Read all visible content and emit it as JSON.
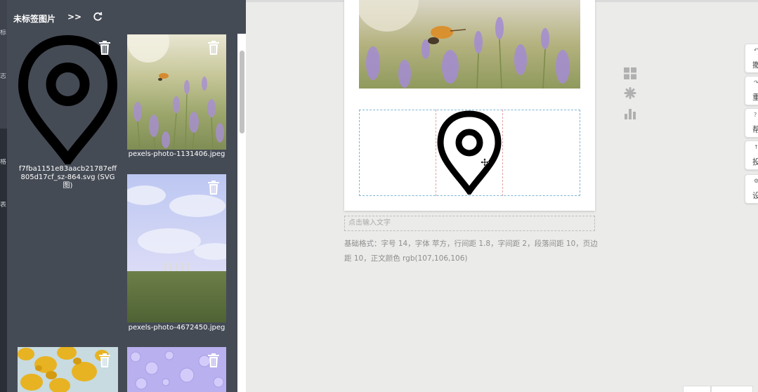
{
  "panel": {
    "title": "未标签图片",
    "expand_label": ">>",
    "refresh_icon": "refresh-icon",
    "delete_icon": "trash-icon",
    "images": [
      {
        "type": "svg-marker",
        "caption": "f7fba1151e83aacb21787eff805d17cf_sz-864.svg (SVG图)"
      },
      {
        "type": "photo-lavender",
        "caption": "pexels-photo-1131406.jpeg"
      },
      {
        "type": "photo-field",
        "caption": "pexels-photo-4672450.jpeg"
      },
      {
        "type": "photo-leaves",
        "caption": ""
      },
      {
        "type": "photo-droplets",
        "caption": ""
      }
    ]
  },
  "left_rail": {
    "glyphs": [
      "标",
      "志",
      "格",
      "表"
    ]
  },
  "editor": {
    "text_placeholder": "点击输入文字",
    "format_info": "基础格式：字号 14，字体 苹方，行间距 1.8，字间距 2，段落间距 10，页边距 10，正文颜色 rgb(107,106,106)"
  },
  "tools": [
    {
      "icon": "grid-icon"
    },
    {
      "icon": "gear-icon"
    },
    {
      "icon": "bar-chart-icon"
    }
  ],
  "side_buttons": [
    {
      "label": "撤",
      "icon": "undo-icon"
    },
    {
      "label": "重",
      "icon": "redo-icon"
    },
    {
      "label": "帮",
      "icon": "help-icon"
    },
    {
      "label": "投",
      "icon": "submit-icon"
    },
    {
      "label": "设",
      "icon": "settings-icon"
    }
  ],
  "colors": {
    "panel_bg": "#454b55",
    "rail_bg": "#3e434d",
    "workspace_bg": "#ebebea",
    "selection_blue": "#7fb6d4",
    "selection_red": "#e4a3a3"
  }
}
